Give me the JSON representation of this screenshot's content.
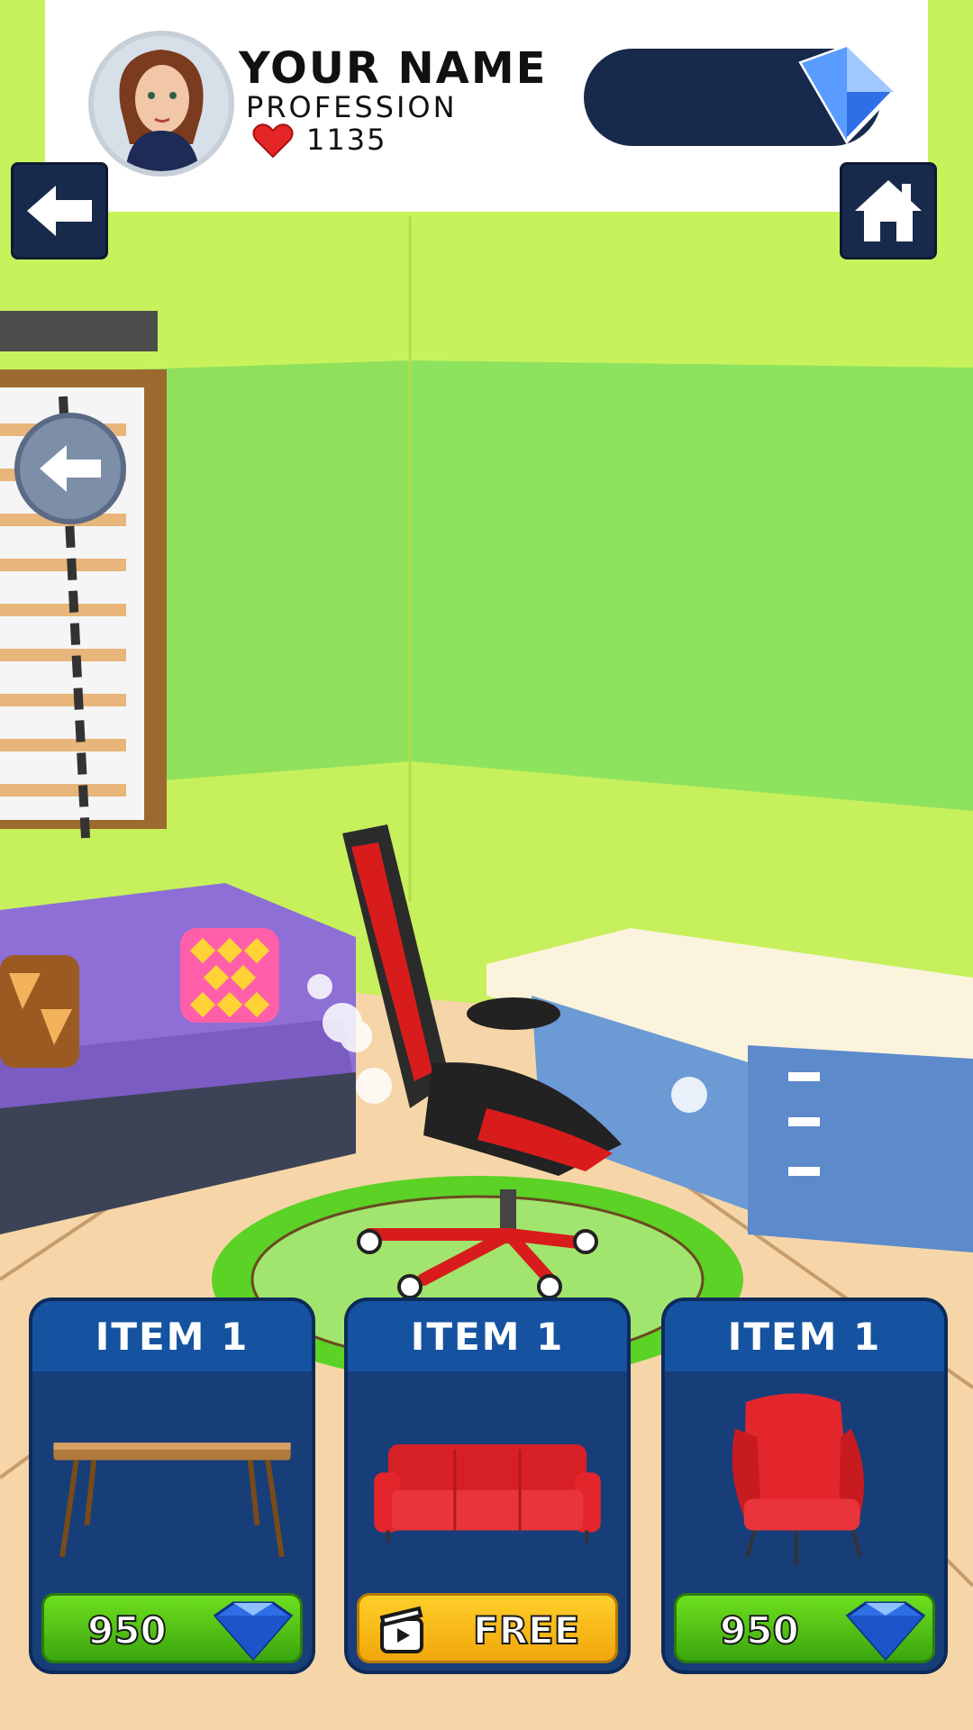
{
  "profile": {
    "name": "YOUR NAME",
    "profession": "PROFESSION",
    "likes": "1135"
  },
  "icons": {
    "back": "arrow-left-icon",
    "home": "home-icon",
    "gem": "diamond-gem-icon",
    "heart": "heart-icon",
    "video": "video-ad-icon"
  },
  "shop": {
    "items": [
      {
        "title": "ITEM 1",
        "image": "wooden-table",
        "price": "950",
        "button_type": "gem"
      },
      {
        "title": "ITEM 1",
        "image": "red-sofa",
        "price": "FREE",
        "button_type": "video"
      },
      {
        "title": "ITEM 1",
        "image": "red-armchair",
        "price": "950",
        "button_type": "gem"
      }
    ]
  },
  "colors": {
    "wall": "#c9f25a",
    "panel": "#182a4c",
    "card": "#183e7a",
    "card_header": "#1553a0",
    "button_green": "#3aa50e",
    "button_yellow": "#f1a60a",
    "gem": "#2e6fe6"
  }
}
